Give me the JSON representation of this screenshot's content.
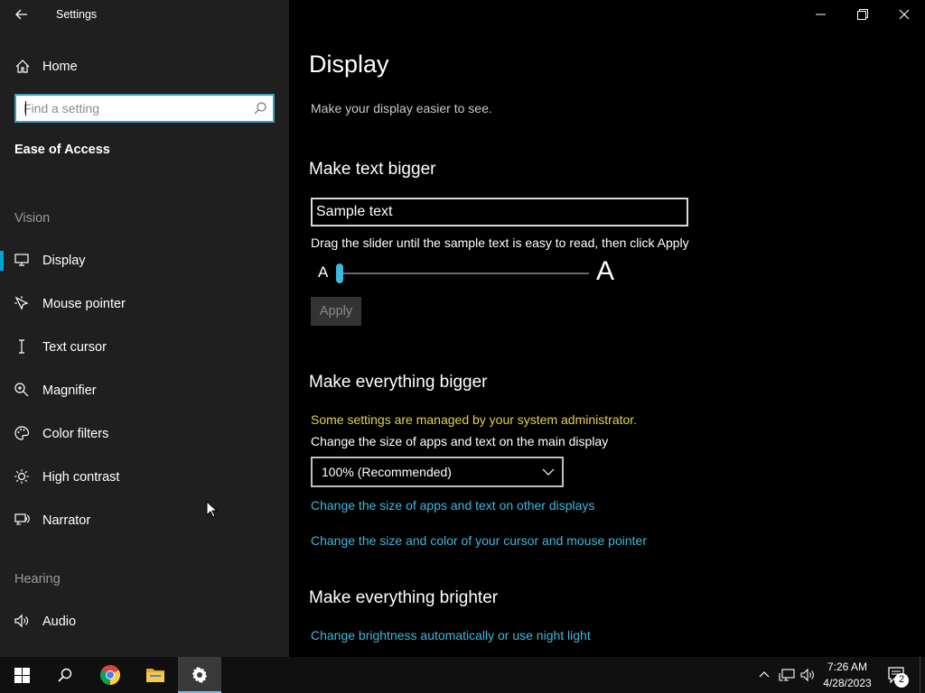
{
  "window": {
    "title": "Settings",
    "controls": [
      "minimize",
      "restore",
      "close"
    ]
  },
  "sidebar": {
    "home_label": "Home",
    "search_placeholder": "Find a setting",
    "category": "Ease of Access",
    "vision_section": "Vision",
    "hearing_section": "Hearing",
    "items": [
      {
        "label": "Display",
        "icon": "monitor-icon",
        "selected": true
      },
      {
        "label": "Mouse pointer",
        "icon": "mouse-pointer-icon"
      },
      {
        "label": "Text cursor",
        "icon": "text-cursor-icon"
      },
      {
        "label": "Magnifier",
        "icon": "magnifier-icon"
      },
      {
        "label": "Color filters",
        "icon": "palette-icon"
      },
      {
        "label": "High contrast",
        "icon": "sun-icon"
      },
      {
        "label": "Narrator",
        "icon": "narrator-icon"
      },
      {
        "label": "Audio",
        "icon": "speaker-icon"
      }
    ]
  },
  "main": {
    "title": "Display",
    "subtitle": "Make your display easier to see.",
    "text_bigger": {
      "heading": "Make text bigger",
      "sample_text": "Sample text",
      "instruction": "Drag the slider until the sample text is easy to read, then click Apply",
      "small_a": "A",
      "large_a": "A",
      "slider_value_percent": 0,
      "apply_label": "Apply"
    },
    "everything_bigger": {
      "heading": "Make everything bigger",
      "admin_notice": "Some settings are managed by your system administrator.",
      "scale_label": "Change the size of apps and text on the main display",
      "scale_value": "100% (Recommended)",
      "link_other_displays": "Change the size of apps and text on other displays",
      "link_cursor": "Change the size and color of your cursor and mouse pointer"
    },
    "everything_brighter": {
      "heading": "Make everything brighter",
      "link_brightness": "Change brightness automatically or use night light"
    }
  },
  "taskbar": {
    "apps": [
      "start-icon",
      "search-icon",
      "chrome-icon",
      "file-explorer-icon",
      "settings-gear-icon"
    ],
    "active_app": "settings-gear-icon",
    "time": "7:26 AM",
    "date": "4/28/2023",
    "notification_count": "2"
  },
  "colors": {
    "accent": "#00a4d6",
    "link": "#3fb7de",
    "warning": "#e4d04a",
    "sidebar_bg": "#1f1f1f",
    "main_bg": "#000000"
  }
}
